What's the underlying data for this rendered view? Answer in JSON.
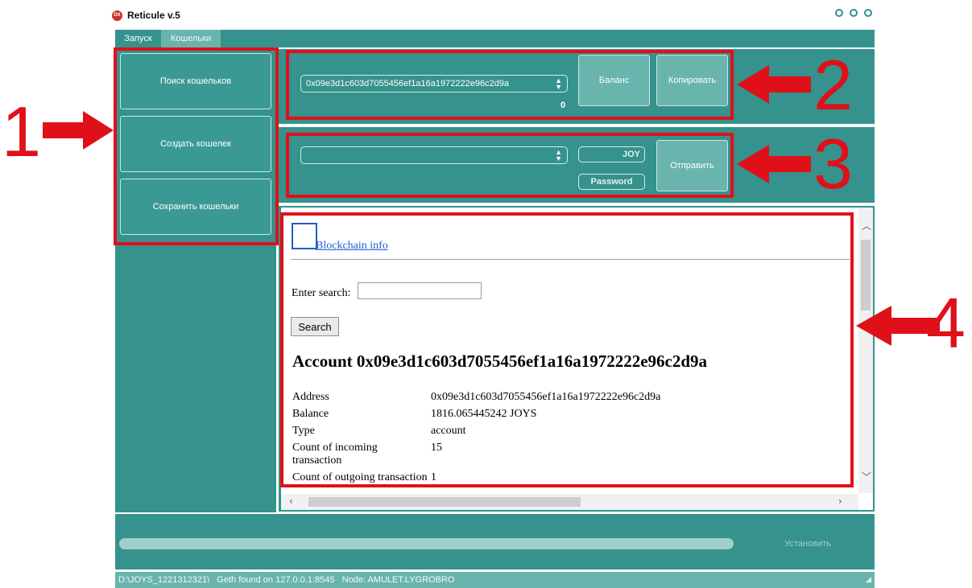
{
  "window": {
    "title": "Reticule v.5",
    "logo_text": "DX"
  },
  "tabs": [
    {
      "label": "Запуск"
    },
    {
      "label": "Кошельки"
    }
  ],
  "sidebar": {
    "items": [
      {
        "label": "Поиск кошельков"
      },
      {
        "label": "Создать кошелек"
      },
      {
        "label": "Сохранить кошельки"
      }
    ]
  },
  "wallet": {
    "selected_address": "0x09e3d1c603d7055456ef1a16a1972222e96c2d9a",
    "balance_value": "0",
    "balance_button": "Баланс",
    "copy_button": "Копировать"
  },
  "send": {
    "recipient_value": "",
    "amount_placeholder": "JOY",
    "password_placeholder": "Password",
    "send_button": "Отправить"
  },
  "browser": {
    "link_text": "Blockchain info",
    "search_label": "Enter search:",
    "search_value": "",
    "search_button": "Search",
    "heading": "Account 0x09e3d1c603d7055456ef1a16a1972222e96c2d9a",
    "rows": [
      {
        "key": "Address",
        "value": "0x09e3d1c603d7055456ef1a16a1972222e96c2d9a"
      },
      {
        "key": "Balance",
        "value": "1816.065445242 JOYS"
      },
      {
        "key": "Type",
        "value": "account"
      },
      {
        "key": "Count of incoming transaction",
        "value": "15"
      },
      {
        "key": "Count of outgoing transaction",
        "value": "1"
      }
    ]
  },
  "footer": {
    "install_button": "Установить",
    "status_text": "D:\\JOYS_1221312321\\   Geth found on 127.0.0.1:8545   Node: AMULET.LYGROBRO"
  },
  "annotations": {
    "color": "#e0101a",
    "labels": [
      "1",
      "2",
      "3",
      "4"
    ]
  },
  "colors": {
    "teal": "#35928c",
    "teal_light": "#6ab4ae"
  }
}
